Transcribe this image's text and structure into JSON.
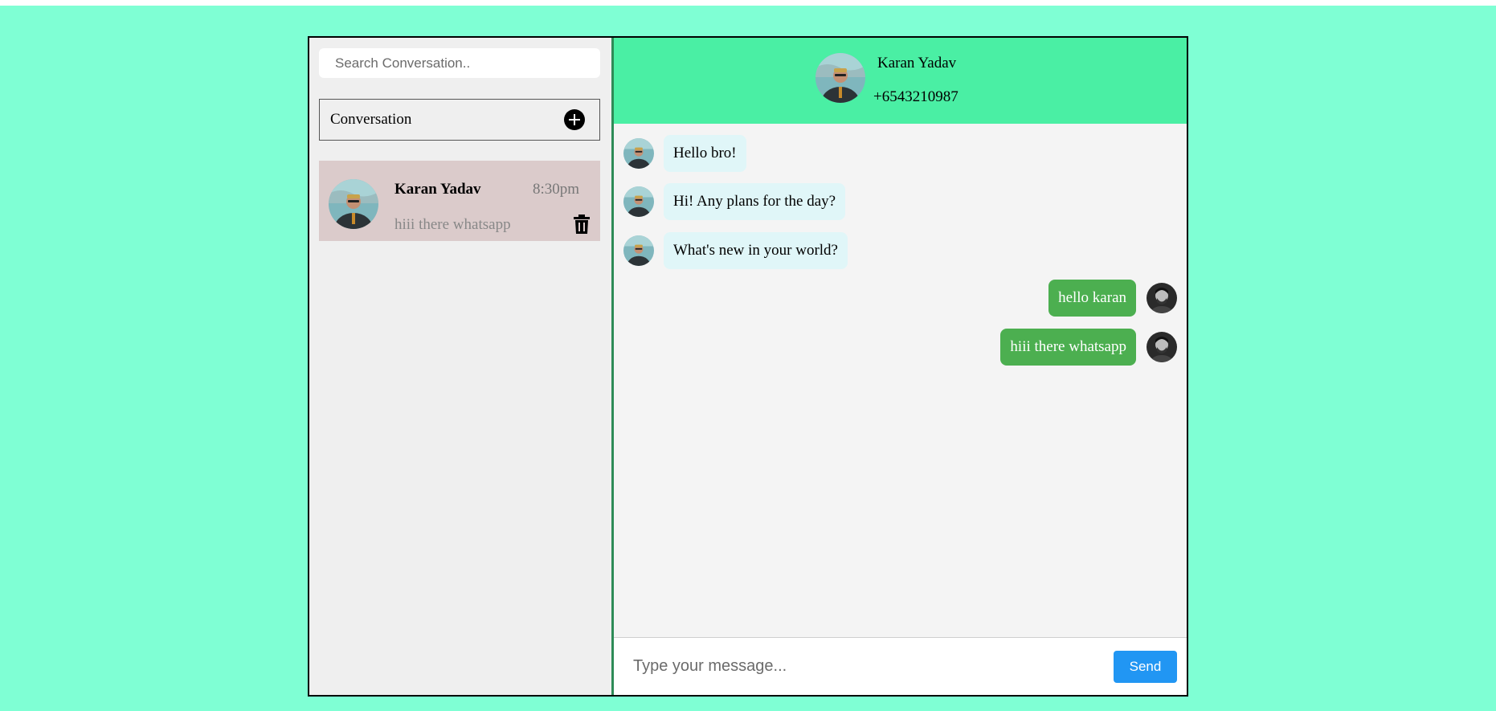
{
  "sidebar": {
    "search": {
      "placeholder": "Search Conversation..",
      "value": ""
    },
    "conversation_header": {
      "label": "Conversation",
      "add_icon": "plus-circle-icon"
    },
    "conversations": [
      {
        "name": "Karan Yadav",
        "time": "8:30pm",
        "preview": "hiii there whatsapp",
        "delete_icon": "trash-icon"
      }
    ]
  },
  "chat": {
    "header": {
      "name": "Karan Yadav",
      "phone": "+6543210987"
    },
    "messages": [
      {
        "direction": "in",
        "text": "Hello bro!"
      },
      {
        "direction": "in",
        "text": "Hi! Any plans for the day?"
      },
      {
        "direction": "in",
        "text": "What's new in your world?"
      },
      {
        "direction": "out",
        "text": "hello karan"
      },
      {
        "direction": "out",
        "text": "hiii there whatsapp"
      }
    ],
    "composer": {
      "placeholder": "Type your message...",
      "value": "",
      "send_label": "Send"
    }
  },
  "colors": {
    "page_background": "#7fffd4",
    "chat_header": "#4aefa4",
    "incoming_bubble": "#e0f6f8",
    "outgoing_bubble": "#4caf50",
    "send_button": "#2196f3",
    "selected_conversation": "#dbcbcb"
  }
}
